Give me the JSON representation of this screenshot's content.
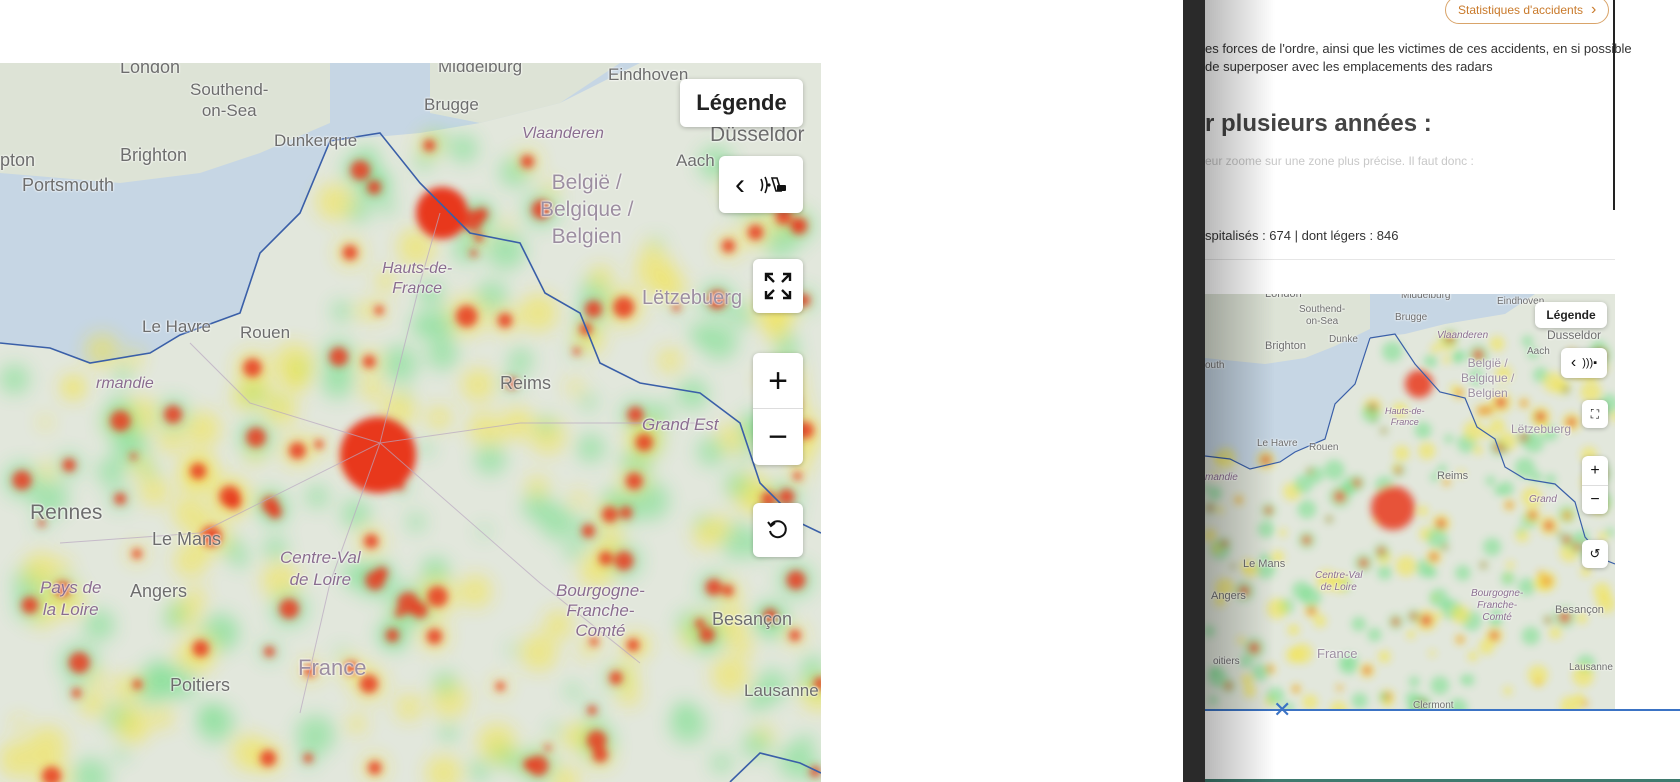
{
  "big_map": {
    "legend_label": "Légende",
    "back_icon": "chevron-left-icon",
    "radar_icon": "speed-camera-icon",
    "fullscreen_icon": "fullscreen-icon",
    "zoom_in_icon": "plus-icon",
    "zoom_out_icon": "minus-icon",
    "reset_icon": "reset-icon",
    "places": [
      "London",
      "Southend-on-Sea",
      "Brighton",
      "Portsmouth",
      "Middelburg",
      "Eindhoven",
      "Brugge",
      "Dunkerque",
      "Vlaanderen",
      "Aach",
      "Düsseldorf",
      "België / Belgique / Belgien",
      "Hauts-de-France",
      "Lëtzebuerg",
      "Le Havre",
      "Rouen",
      "Normandie",
      "Reims",
      "Grand Est",
      "Rennes",
      "Le Mans",
      "Centre-Val de Loire",
      "Pays de la Loire",
      "Angers",
      "Bourgogne-Franche-Comté",
      "Besançon",
      "France",
      "Poitiers",
      "Lausanne"
    ]
  },
  "article": {
    "stats_button": "Statistiques d'accidents",
    "chevron_icon": "chevron-right-icon",
    "paragraph": "es forces de l'ordre, ainsi que les victimes de ces accidents, en si possible de superposer avec les emplacements des radars",
    "heading": "r plusieurs années :",
    "faded_text": "eur zoome sur une zone plus précise. Il faut donc :",
    "stats_line": "spitalisés : 674 | dont légers : 846"
  },
  "small_map": {
    "legend_label": "Légende",
    "places": [
      "London",
      "Southend-on-Sea",
      "Brighton",
      "outh",
      "Middelburg",
      "Eindhoven",
      "Brugge",
      "Dunke",
      "Vlaanderen",
      "Aach",
      "Dusseldor",
      "België / Belgique / Belgien",
      "Hauts-de-France",
      "Lëtzebuerg",
      "Le Havre",
      "Rouen",
      "mandie",
      "Reims",
      "Grand",
      "Le Mans",
      "Centre-Val de Loire",
      "Angers",
      "Bourgogne-Franche-Comté",
      "Besançon",
      "France",
      "oitiers",
      "Lausanne",
      "Clermont"
    ]
  },
  "close_icon": "close-icon",
  "colors": {
    "heat_high": "#e8391f",
    "heat_mid": "#f7e425",
    "heat_low": "#5fdc7a",
    "sea": "#c6d6e4",
    "land": "#e2e7dc",
    "border": "#3a5fa8",
    "link_accent": "#c97a2b"
  }
}
